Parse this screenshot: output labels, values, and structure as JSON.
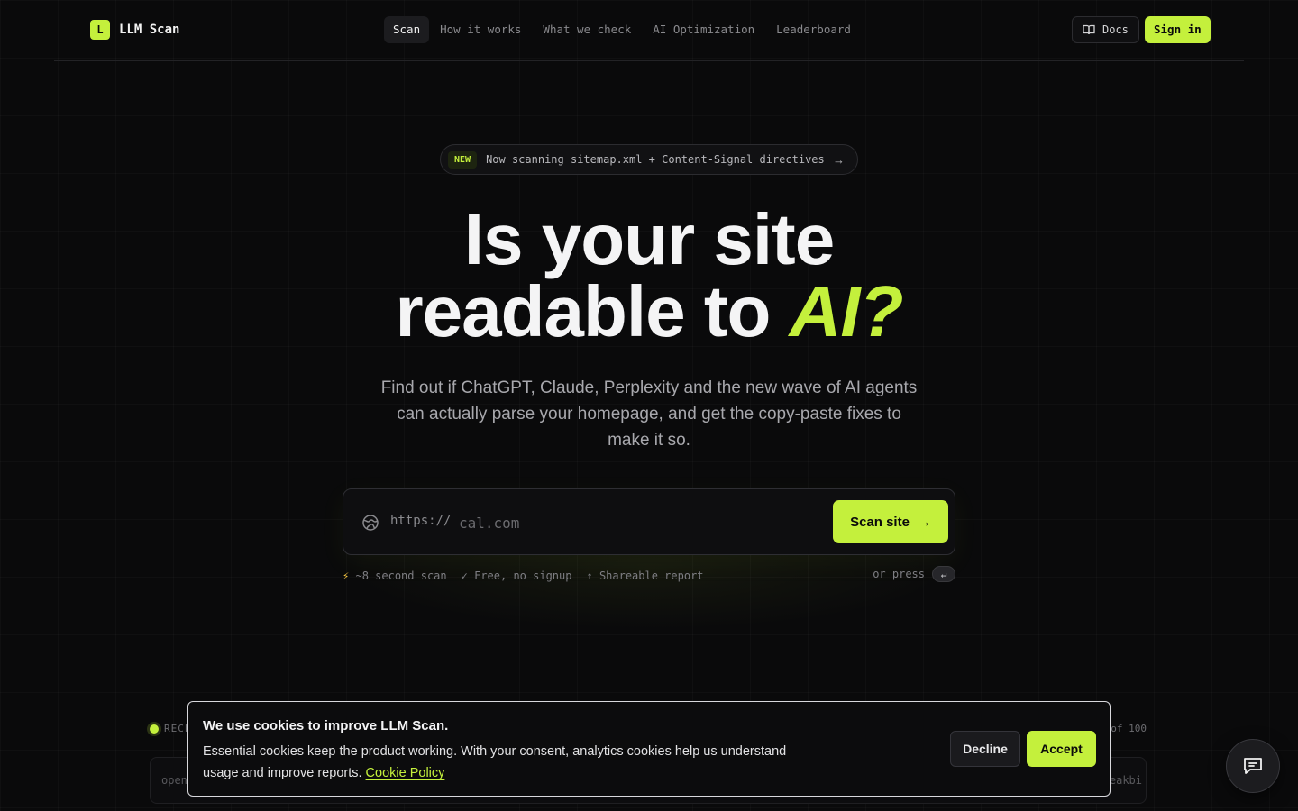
{
  "brand": {
    "mark": "L",
    "name": "LLM Scan"
  },
  "nav": {
    "items": [
      {
        "label": "Scan",
        "active": true
      },
      {
        "label": "How it works"
      },
      {
        "label": "What we check"
      },
      {
        "label": "AI Optimization"
      },
      {
        "label": "Leaderboard"
      }
    ]
  },
  "header": {
    "docs_label": "Docs",
    "signin_label": "Sign in"
  },
  "announcement": {
    "badge": "NEW",
    "text": "Now scanning sitemap.xml + Content-Signal directives",
    "arrow": "→"
  },
  "hero": {
    "title_line1": "Is your site",
    "title_line2_prefix": "readable to ",
    "title_accent": "AI?",
    "subtitle": "Find out if ChatGPT, Claude, Perplexity and the new wave of AI agents can actually parse your homepage, and get the copy-paste fixes to make it so."
  },
  "scan": {
    "prefix": "https://",
    "placeholder": "cal.com",
    "value": "",
    "button_label": "Scan site",
    "button_arrow": "→"
  },
  "meta": {
    "features": [
      {
        "icon": "⚡",
        "label": "~8 second scan"
      },
      {
        "icon": "✓",
        "label": "Free, no signup"
      },
      {
        "icon": "↑",
        "label": "Shareable report"
      }
    ],
    "press_label": "or press",
    "press_key": "↵"
  },
  "recent": {
    "label": "RECE",
    "count": "of 100",
    "left_item": "open",
    "right_item": "eakbi"
  },
  "cookie": {
    "title": "We use cookies to improve LLM Scan.",
    "text": "Essential cookies keep the product working. With your consent, analytics cookies help us understand usage and improve reports.",
    "link": "Cookie Policy",
    "decline_label": "Decline",
    "accept_label": "Accept"
  },
  "colors": {
    "accent": "#c4f03c",
    "background": "#0a0a0b"
  },
  "icons": {
    "docs": "book-icon",
    "scan_input": "globe-icon",
    "chat": "chat-bubble-icon"
  }
}
